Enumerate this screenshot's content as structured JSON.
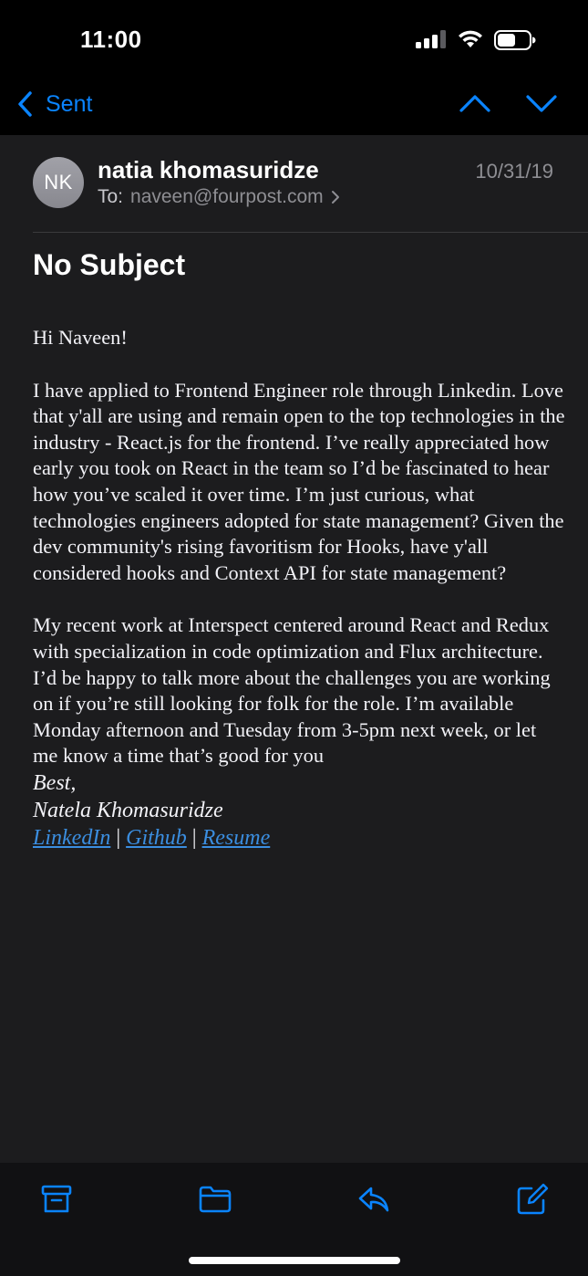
{
  "status_bar": {
    "time": "11:00"
  },
  "nav": {
    "back_label": "Sent"
  },
  "email": {
    "avatar_initials": "NK",
    "sender": "natia khomasuridze",
    "date": "10/31/19",
    "to_label": "To:",
    "to_address": "naveen@fourpost.com",
    "subject": "No Subject",
    "body": {
      "greeting": "Hi Naveen!",
      "paragraph_1": "I have applied to Frontend Engineer role through Linkedin. Love that y'all are using and remain open to the top technologies in the industry -  React.js for the frontend. I’ve really appreciated how early you took on React in the team so I’d be fascinated to hear how you’ve scaled it over time. I’m just curious, what technologies engineers adopted for state management? Given the dev community's rising favoritism for Hooks, have y'all considered hooks and Context API for state management?",
      "paragraph_2": "My recent work at Interspect centered around React and Redux with specialization in code optimization and Flux architecture. I’d be happy to talk more about the challenges you are working on if you’re still looking for folk for the role. I’m available Monday afternoon and Tuesday from 3-5pm next week, or let me know a time that’s good for you",
      "signoff": "Best,",
      "signature_name": "Natela Khomasuridze",
      "links": [
        "LinkedIn",
        "Github",
        "Resume"
      ],
      "link_separator": "|"
    }
  },
  "colors": {
    "accent": "#0a84ff",
    "link": "#3b8ee0",
    "background": "#1c1c1e",
    "secondary_text": "#8e8e93"
  },
  "icons": {
    "toolbar": [
      "archive-icon",
      "folder-icon",
      "reply-icon",
      "compose-icon"
    ]
  }
}
